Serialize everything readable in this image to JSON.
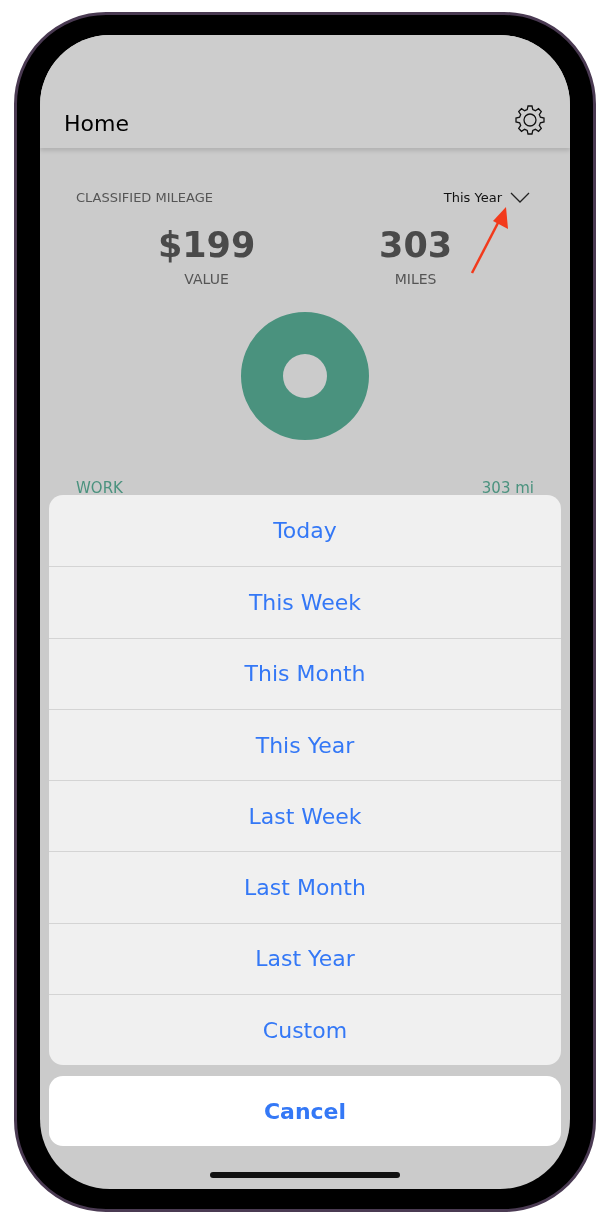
{
  "header": {
    "title": "Home"
  },
  "card": {
    "title": "CLASSIFIED MILEAGE",
    "period": "This Year",
    "stats": [
      {
        "value": "$199",
        "label": "VALUE"
      },
      {
        "value": "303",
        "label": "MILES"
      }
    ],
    "categories": [
      {
        "name": "WORK",
        "amount": "303 mi",
        "color": "#4a927e"
      }
    ]
  },
  "action_sheet": {
    "options": [
      "Today",
      "This Week",
      "This Month",
      "This Year",
      "Last Week",
      "Last Month",
      "Last Year",
      "Custom"
    ],
    "cancel": "Cancel"
  }
}
